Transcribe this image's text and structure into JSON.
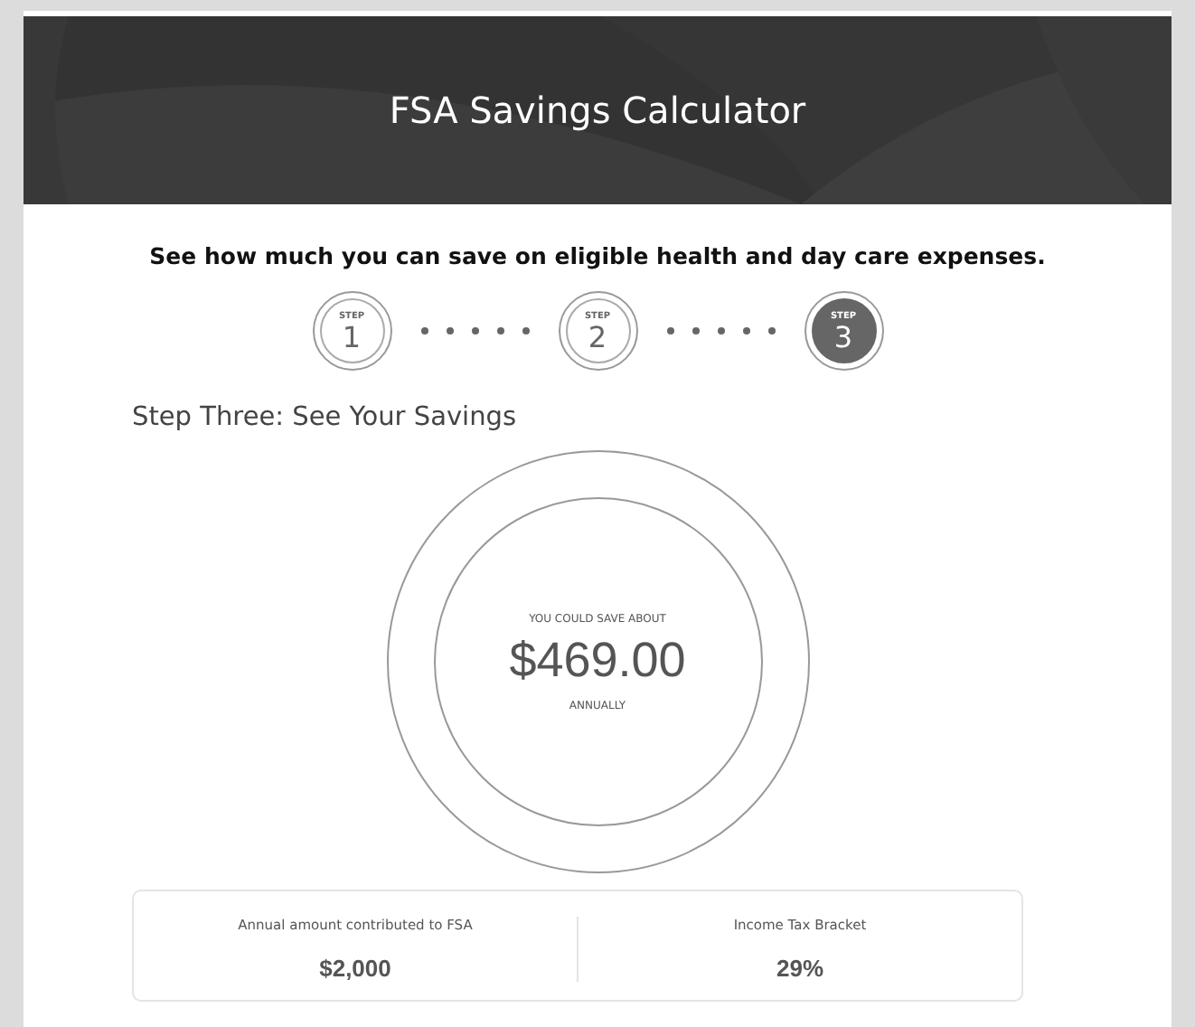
{
  "header": {
    "title": "FSA Savings Calculator"
  },
  "subtitle": "See how much you can save on eligible health and day care expenses.",
  "steps": [
    {
      "label": "STEP",
      "number": "1",
      "selected": false
    },
    {
      "label": "STEP",
      "number": "2",
      "selected": false
    },
    {
      "label": "STEP",
      "number": "3",
      "selected": true
    }
  ],
  "section_title": "Step Three: See Your Savings",
  "result": {
    "caption": "YOU COULD SAVE ABOUT",
    "amount": "$469.00",
    "period": "ANNUALLY"
  },
  "summary": [
    {
      "label": "Annual amount contributed to FSA",
      "value": "$2,000"
    },
    {
      "label": "Income Tax Bracket",
      "value": "29%"
    }
  ]
}
